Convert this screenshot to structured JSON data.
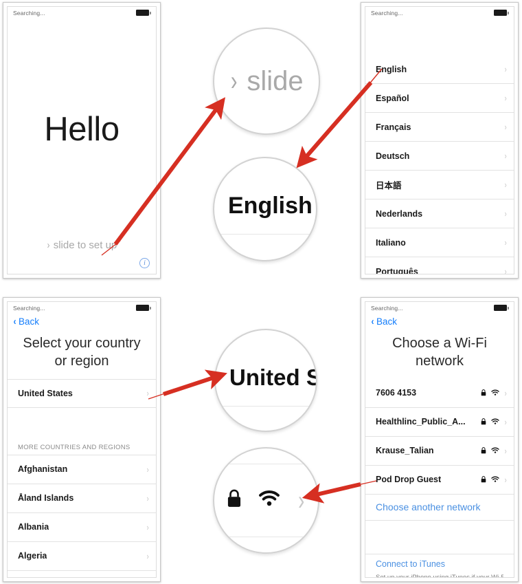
{
  "status_bar": {
    "text": "Searching...",
    "battery_icon": "battery-full-icon"
  },
  "colors": {
    "ios_blue": "#157efb",
    "link_blue": "#4a90e2",
    "arrow_red": "#d62f22",
    "divider": "#e2e2e2",
    "muted_gray": "#a8a8a8"
  },
  "panel_hello": {
    "name": "hello-welcome-screen",
    "greeting": "Hello",
    "slide_chevron": "›",
    "slide_label": "slide to set up",
    "info_button_label": "i"
  },
  "panel_language": {
    "name": "language-select-screen",
    "items": [
      {
        "label": "English",
        "chevron": "›"
      },
      {
        "label": "Español",
        "chevron": "›"
      },
      {
        "label": "Français",
        "chevron": "›"
      },
      {
        "label": "Deutsch",
        "chevron": "›"
      },
      {
        "label": "日本語",
        "chevron": "›"
      },
      {
        "label": "Nederlands",
        "chevron": "›"
      },
      {
        "label": "Italiano",
        "chevron": "›"
      },
      {
        "label": "Português",
        "chevron": "›"
      }
    ]
  },
  "panel_country": {
    "name": "country-region-select-screen",
    "back_label": "Back",
    "back_chevron": "‹",
    "title": "Select your country or region",
    "selected_country": {
      "label": "United States",
      "chevron": "›"
    },
    "section_header": "MORE COUNTRIES AND REGIONS",
    "items": [
      {
        "label": "Afghanistan",
        "chevron": "›"
      },
      {
        "label": "Åland Islands",
        "chevron": "›"
      },
      {
        "label": "Albania",
        "chevron": "›"
      },
      {
        "label": "Algeria",
        "chevron": "›"
      }
    ]
  },
  "panel_wifi": {
    "name": "wifi-select-screen",
    "back_label": "Back",
    "back_chevron": "‹",
    "title": "Choose a Wi-Fi network",
    "networks": [
      {
        "label": "7606 4153",
        "lock": "lock-icon",
        "signal": "wifi-icon",
        "chevron": "›"
      },
      {
        "label": "Healthlinc_Public_A...",
        "lock": "lock-icon",
        "signal": "wifi-icon",
        "chevron": "›"
      },
      {
        "label": "Krause_Talian",
        "lock": "lock-icon",
        "signal": "wifi-icon",
        "chevron": "›"
      },
      {
        "label": "Pod Drop Guest",
        "lock": "lock-icon",
        "signal": "wifi-icon",
        "chevron": "›"
      }
    ],
    "choose_another": "Choose another network",
    "itunes_link": "Connect to iTunes",
    "itunes_sub": "Set up your iPhone using iTunes if your Wi-Fi..."
  },
  "magnifiers": {
    "slide": {
      "name": "magnifier-slide",
      "chevron": "›",
      "text": "slide"
    },
    "english": {
      "name": "magnifier-english",
      "text": "English"
    },
    "united_states": {
      "name": "magnifier-united-states",
      "text": "United S"
    },
    "wifi_icons": {
      "name": "magnifier-wifi-row-icons",
      "lock": "lock-icon",
      "signal": "wifi-icon",
      "chevron": "›"
    }
  },
  "arrows": [
    {
      "name": "arrow-slide-to-magnifier"
    },
    {
      "name": "arrow-english-list-to-magnifier"
    },
    {
      "name": "arrow-united-states-to-magnifier"
    },
    {
      "name": "arrow-wifi-row-to-magnifier"
    }
  ]
}
